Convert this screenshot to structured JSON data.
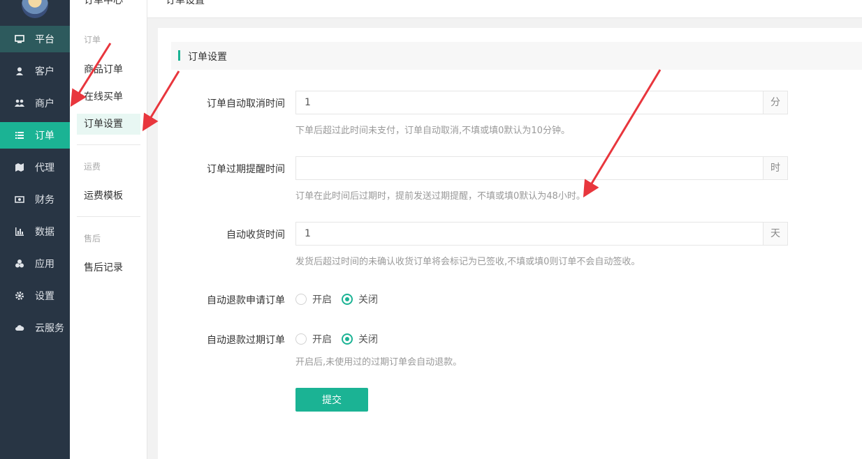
{
  "sidebar": {
    "items": [
      {
        "label": "平台",
        "icon": "monitor-icon"
      },
      {
        "label": "客户",
        "icon": "user-icon"
      },
      {
        "label": "商户",
        "icon": "users-icon"
      },
      {
        "label": "订单",
        "icon": "list-icon"
      },
      {
        "label": "代理",
        "icon": "map-icon"
      },
      {
        "label": "财务",
        "icon": "money-icon"
      },
      {
        "label": "数据",
        "icon": "bar-chart-icon"
      },
      {
        "label": "应用",
        "icon": "cubes-icon"
      },
      {
        "label": "设置",
        "icon": "gear-icon"
      },
      {
        "label": "云服务",
        "icon": "cloud-icon"
      }
    ],
    "active": "订单"
  },
  "subnav": {
    "title": "订单中心",
    "groups": [
      {
        "label": "订单",
        "links": [
          "商品订单",
          "在线买单",
          "订单设置"
        ]
      },
      {
        "label": "运费",
        "links": [
          "运费模板"
        ]
      },
      {
        "label": "售后",
        "links": [
          "售后记录"
        ]
      }
    ],
    "active": "订单设置"
  },
  "breadcrumb": "订单设置",
  "section_title": "订单设置",
  "form": {
    "cancel_time": {
      "label": "订单自动取消时间",
      "value": "1",
      "unit": "分",
      "hint": "下单后超过此时间未支付，订单自动取消,不填或填0默认为10分钟。"
    },
    "expire_remind": {
      "label": "订单过期提醒时间",
      "value": "",
      "unit": "时",
      "hint": "订单在此时间后过期时，提前发送过期提醒，不填或填0默认为48小时。"
    },
    "auto_receive": {
      "label": "自动收货时间",
      "value": "1",
      "unit": "天",
      "hint": "发货后超过时间的未确认收货订单将会标记为已签收,不填或填0则订单不会自动签收。"
    },
    "refund_apply": {
      "label": "自动退款申请订单",
      "on": "开启",
      "off": "关闭",
      "selected": "关闭"
    },
    "refund_expire": {
      "label": "自动退款过期订单",
      "on": "开启",
      "off": "关闭",
      "selected": "关闭",
      "hint": "开启后,未使用过的过期订单会自动退款。"
    },
    "submit_label": "提交"
  },
  "colors": {
    "accent": "#1bb394",
    "sidebar": "#283544",
    "arrow": "#e8363d"
  }
}
